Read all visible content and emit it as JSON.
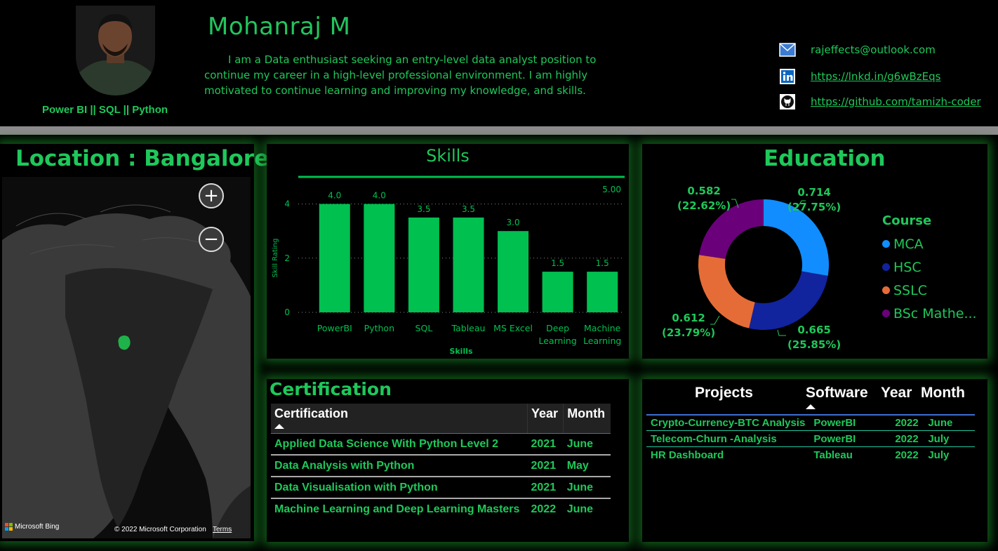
{
  "header": {
    "name": "Mohanraj M",
    "tagline": "Power BI || SQL || Python",
    "bio": "I am a Data enthusiast seeking an entry-level data analyst position to continue my career in a high-level professional environment. I am highly motivated to continue learning and improving my knowledge, and skills.",
    "contacts": [
      {
        "icon": "mail-icon",
        "text": "rajeffects@outlook.com"
      },
      {
        "icon": "linkedin-icon",
        "text": "https://lnkd.in/g6wBzEqs"
      },
      {
        "icon": "github-icon",
        "text": "https://github.com/tamizh-coder"
      }
    ]
  },
  "map": {
    "title": "Location : Bangalore",
    "zoom_in": "+",
    "zoom_out": "−",
    "attribution": "Microsoft Bing",
    "copyright": "© 2022 Microsoft Corporation",
    "terms": "Terms"
  },
  "skills": {
    "title": "Skills"
  },
  "chart_data": {
    "type": "bar",
    "title": "Skills",
    "xlabel": "Skills",
    "ylabel": "Skill Rating",
    "categories": [
      "PowerBI",
      "Python",
      "SQL",
      "Tableau",
      "MS Excel",
      "Deep Learning",
      "Machine Learning"
    ],
    "values": [
      4.0,
      4.0,
      3.5,
      3.5,
      3.0,
      1.5,
      1.5
    ],
    "data_labels": [
      "4.0",
      "4.0",
      "3.5",
      "3.5",
      "3.0",
      "1.5",
      "1.5"
    ],
    "yticks": [
      0,
      2,
      4
    ],
    "ylim": [
      0,
      5
    ],
    "reference_line": {
      "value": 5.0,
      "label": "5.00"
    },
    "bar_color": "#00c050",
    "grid": "dotted"
  },
  "education": {
    "title": "Education",
    "legend_title": "Course",
    "chart_data": {
      "type": "pie",
      "donut": true,
      "slices": [
        {
          "name": "MCA",
          "value": 0.714,
          "percent": "27.75%",
          "color": "#118dff"
        },
        {
          "name": "HSC",
          "value": 0.665,
          "percent": "25.85%",
          "color": "#12239e"
        },
        {
          "name": "SSLC",
          "value": 0.612,
          "percent": "23.79%",
          "color": "#e66c37"
        },
        {
          "name": "BSc Mathe...",
          "value": 0.582,
          "percent": "22.62%",
          "color": "#6b007b"
        }
      ]
    }
  },
  "certification": {
    "title": "Certification",
    "columns": [
      "Certification",
      "Year",
      "Month"
    ],
    "rows": [
      [
        "Applied Data Science With Python Level 2",
        "2021",
        "June"
      ],
      [
        "Data Analysis with Python",
        "2021",
        "May"
      ],
      [
        "Data Visualisation with Python",
        "2021",
        "June"
      ],
      [
        "Machine Learning and Deep Learning Masters",
        "2022",
        "June"
      ]
    ]
  },
  "projects": {
    "columns": [
      "Projects",
      "Software",
      "Year",
      "Month"
    ],
    "rows": [
      [
        "Crypto-Currency-BTC Analysis",
        "PowerBI",
        "2022",
        "June"
      ],
      [
        "Telecom-Churn -Analysis",
        "PowerBI",
        "2022",
        "July"
      ],
      [
        "HR Dashboard",
        "Tableau",
        "2022",
        "July"
      ]
    ]
  }
}
